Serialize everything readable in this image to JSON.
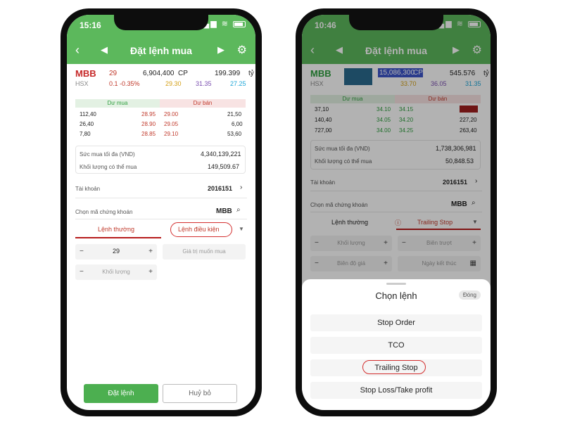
{
  "screen1": {
    "status_time": "15:16",
    "nav_title": "Đặt lệnh mua",
    "symbol": "MBB",
    "exchange": "HSX",
    "price": "29",
    "change": "0.1 -0.35%",
    "volume": "6,904,400",
    "volume_unit": "CP",
    "value": "199.399",
    "value_unit": "tỷ",
    "ref_price": "29.30",
    "ceiling": "31.35",
    "floor": "27.25",
    "buy_header": "Dư mua",
    "sell_header": "Dư bán",
    "book": [
      {
        "buy_vol": "112,40",
        "buy_price": "28.95",
        "sell_price": "29.00",
        "sell_vol": "21,50"
      },
      {
        "buy_vol": "26,40",
        "buy_price": "28.90",
        "sell_price": "29.05",
        "sell_vol": "6,00"
      },
      {
        "buy_vol": "7,80",
        "buy_price": "28.85",
        "sell_price": "29.10",
        "sell_vol": "53,60"
      }
    ],
    "max_buy_label": "Sức mua tối đa (VND)",
    "max_buy_value": "4,340,139,221",
    "max_qty_label": "Khối lượng có thể mua",
    "max_qty_value": "149,509.67",
    "account_label": "Tài khoản",
    "account_value": "2016151",
    "select_symbol_label": "Chọn mã chứng khoán",
    "selected_symbol": "MBB",
    "tab_normal": "Lệnh thường",
    "tab_conditional": "Lệnh điều kiện",
    "price_field_value": "29",
    "desired_value_placeholder": "Giá trị muốn mua",
    "qty_placeholder": "Khối lượng",
    "place_order": "Đặt lệnh",
    "cancel": "Huỷ bỏ"
  },
  "screen2": {
    "status_time": "10:46",
    "nav_title": "Đặt lệnh mua",
    "symbol": "MBB",
    "exchange": "HSX",
    "highlight_value": "15,086,300",
    "highlight_unit": "CP",
    "value": "545.576",
    "value_unit": "tỷ",
    "ref_price": "33.70",
    "ceiling": "36.05",
    "floor": "31.35",
    "buy_header": "Dư mua",
    "sell_header": "Dư bán",
    "book": [
      {
        "buy_vol": "37,10",
        "buy_price": "34.10",
        "sell_price": "34.15",
        "sell_vol": ""
      },
      {
        "buy_vol": "140,40",
        "buy_price": "34.05",
        "sell_price": "34.20",
        "sell_vol": "227,20"
      },
      {
        "buy_vol": "727,00",
        "buy_price": "34.00",
        "sell_price": "34.25",
        "sell_vol": "263,40"
      }
    ],
    "max_buy_label": "Sức mua tối đa (VND)",
    "max_buy_value": "1,738,306,981",
    "max_qty_label": "Khối lượng có thể mua",
    "max_qty_value": "50,848.53",
    "account_label": "Tài khoản",
    "account_value": "2016151",
    "select_symbol_label": "Chọn mã chứng khoán",
    "selected_symbol": "MBB",
    "tab_normal": "Lệnh thường",
    "tab_trailing": "Trailing Stop",
    "qty_placeholder": "Khối lượng",
    "range_placeholder": "Biên trượt",
    "price_gap_placeholder": "Biên độ giá",
    "end_date_placeholder": "Ngày kết thúc",
    "sheet_title": "Chọn lệnh",
    "sheet_close": "Đóng",
    "options": [
      "Stop Order",
      "TCO",
      "Trailing Stop",
      "Stop Loss/Take profit"
    ]
  }
}
